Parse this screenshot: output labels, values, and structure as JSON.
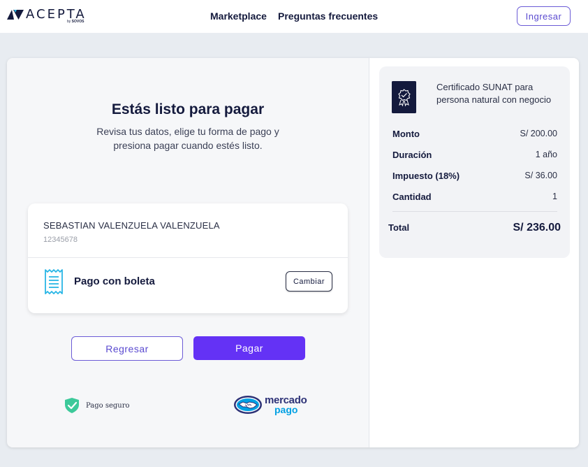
{
  "header": {
    "logo_text": "ACEPTA",
    "logo_sub_prefix": "by",
    "logo_sub_brand": "SOVOS",
    "nav": [
      "Marketplace",
      "Preguntas frecuentes"
    ],
    "login_label": "Ingresar"
  },
  "checkout": {
    "title": "Estás listo para pagar",
    "subtitle": "Revisa tus datos, elige tu forma de pago y presiona pagar cuando estés listo.",
    "buyer_name": "SEBASTIAN VALENZUELA VALENZUELA",
    "buyer_id": "12345678",
    "payment_method": "Pago con boleta",
    "change_label": "Cambiar",
    "back_label": "Regresar",
    "pay_label": "Pagar",
    "secure_label": "Pago seguro",
    "provider_line1": "mercado",
    "provider_line2": "pago"
  },
  "summary": {
    "product_name": "Certificado SUNAT para persona natural con negocio",
    "rows": [
      {
        "label": "Monto",
        "value": "S/ 200.00"
      },
      {
        "label": "Duración",
        "value": "1 año"
      },
      {
        "label": "Impuesto (18%)",
        "value": "S/ 36.00"
      },
      {
        "label": "Cantidad",
        "value": "1"
      }
    ],
    "total_label": "Total",
    "total_value": "S/ 236.00"
  },
  "colors": {
    "primary": "#6432f5",
    "brand_dark": "#141a3d",
    "accent_cyan": "#29b6e6",
    "secure_green": "#3cc99a",
    "page_bg": "#e8ecf1"
  },
  "icons": [
    "acepta-logo-icon",
    "receipt-icon",
    "shield-check-icon",
    "certificate-badge-icon",
    "mercadopago-handshake-icon"
  ]
}
